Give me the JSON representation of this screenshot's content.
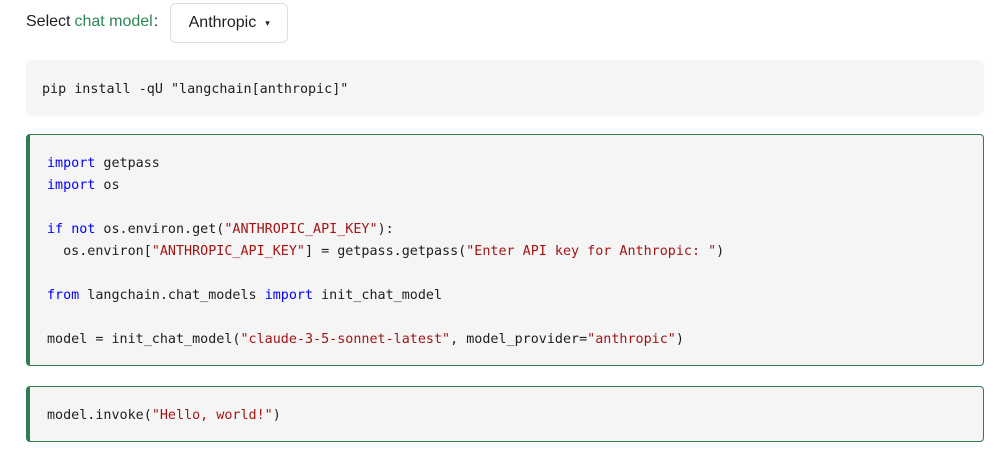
{
  "selector": {
    "prefix": "Select",
    "link_text": "chat model",
    "suffix": ":",
    "dropdown_value": "Anthropic",
    "caret": "▾"
  },
  "install_block": {
    "command": "pip install -qU \"langchain[anthropic]\""
  },
  "main_block": {
    "line1_kw": "import",
    "line1_txt": " getpass",
    "line2_kw": "import",
    "line2_txt": " os",
    "line4_kw1": "if",
    "line4_sp": " ",
    "line4_kw2": "not",
    "line4_txt1": " os.environ.get(",
    "line4_str": "\"ANTHROPIC_API_KEY\"",
    "line4_txt2": "):",
    "line5_txt1": "  os.environ[",
    "line5_str1": "\"ANTHROPIC_API_KEY\"",
    "line5_txt2": "] = getpass.getpass(",
    "line5_str2": "\"Enter API key for Anthropic: \"",
    "line5_txt3": ")",
    "line7_kw1": "from",
    "line7_txt1": " langchain.chat_models ",
    "line7_kw2": "import",
    "line7_txt2": " init_chat_model",
    "line9_txt1": "model = init_chat_model(",
    "line9_str1": "\"claude-3-5-sonnet-latest\"",
    "line9_txt2": ", model_provider=",
    "line9_str2": "\"anthropic\"",
    "line9_txt3": ")"
  },
  "invoke_block": {
    "txt1": "model.invoke(",
    "str1": "\"Hello, world!\"",
    "txt2": ")"
  }
}
